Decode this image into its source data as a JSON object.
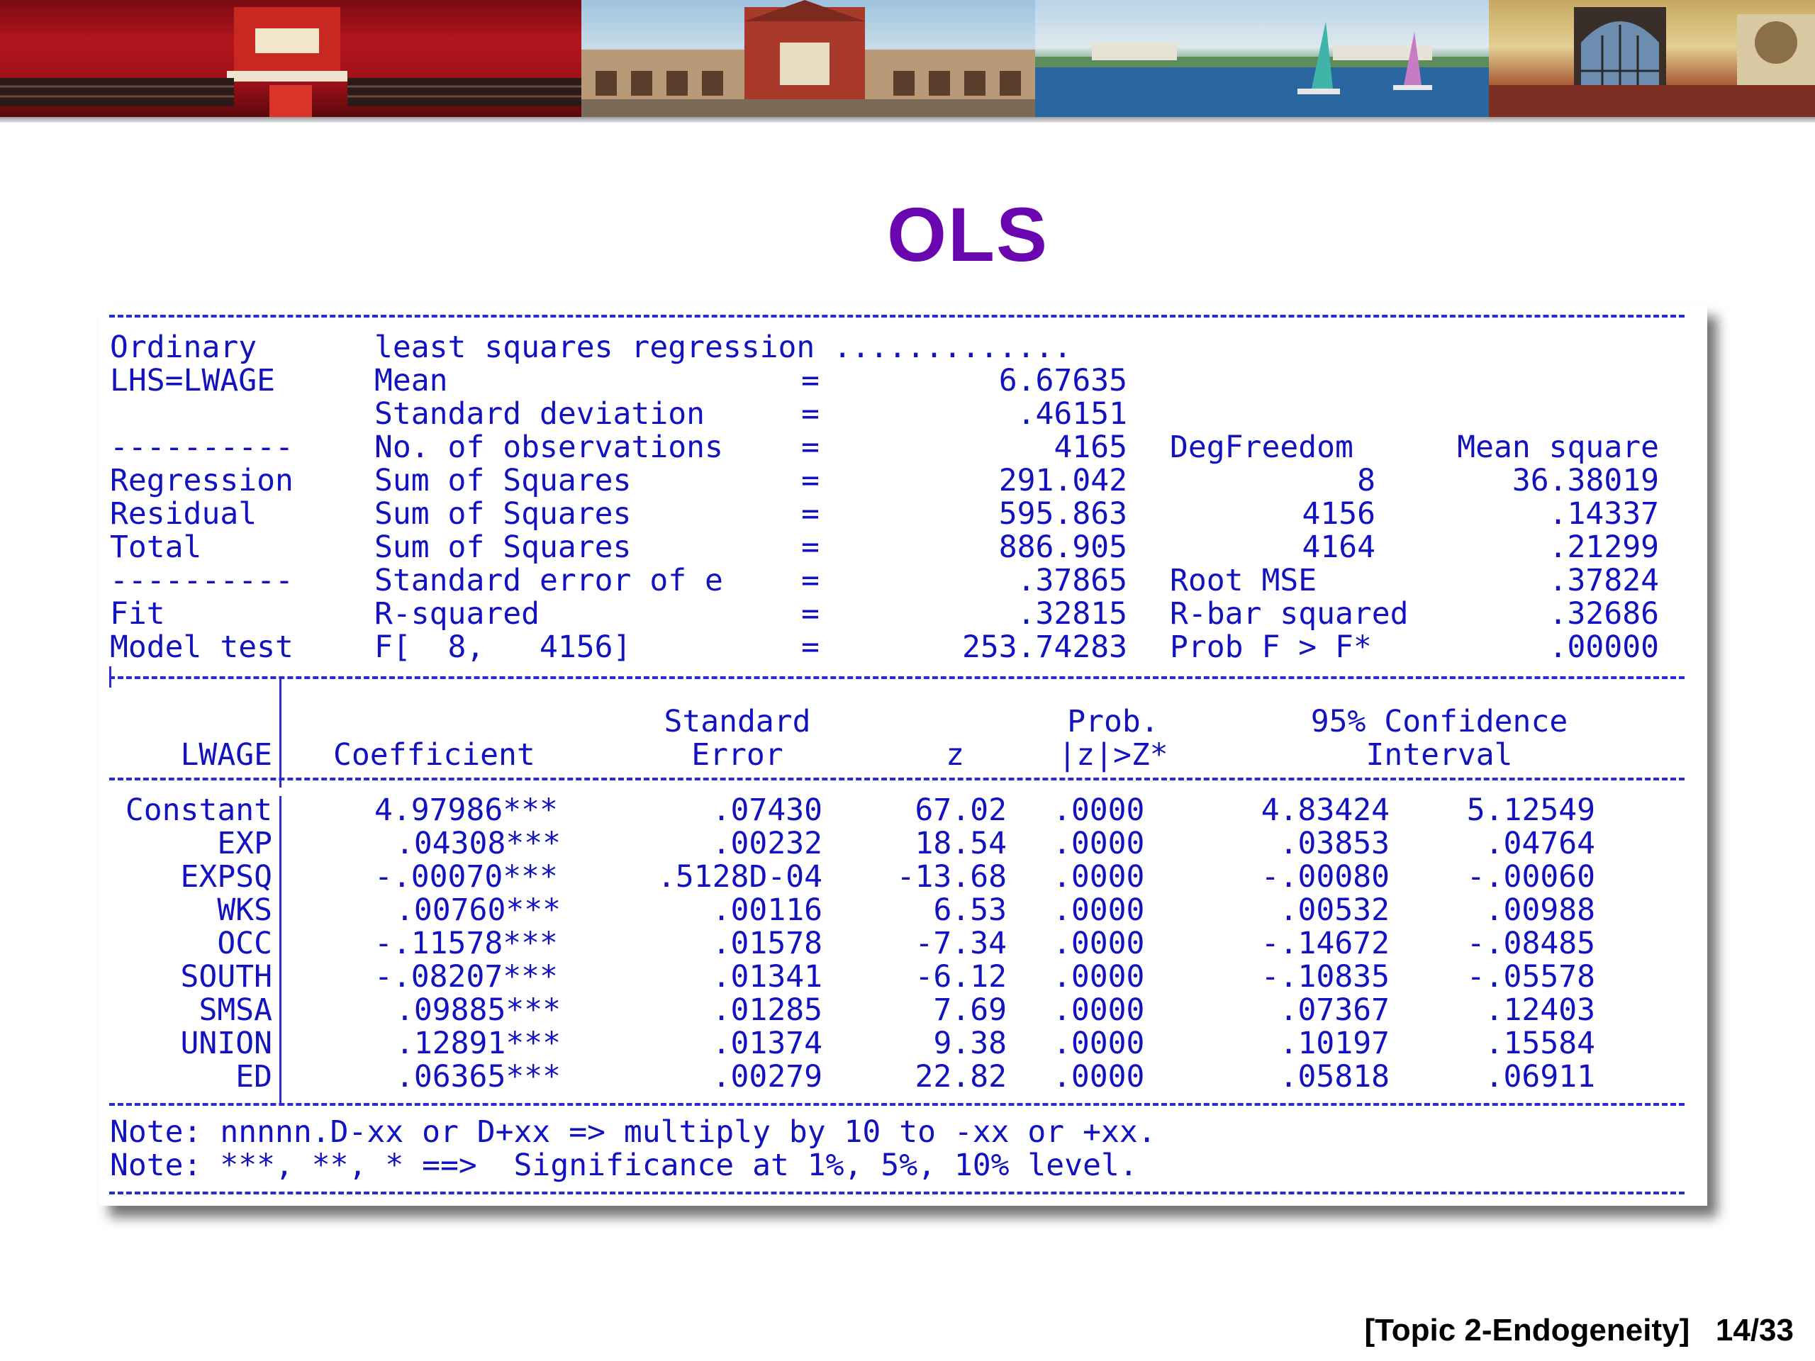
{
  "slide": {
    "title": "OLS",
    "footer": "[Topic 2-Endogeneity]   14/33"
  },
  "summary": {
    "row0": {
      "left": "Ordinary",
      "label": "least squares regression .............",
      "eq": "",
      "value": "",
      "df": "",
      "ms": ""
    },
    "row1": {
      "left": "LHS=LWAGE",
      "label": "Mean",
      "eq": "=",
      "value": "6.67635",
      "df": "",
      "ms": ""
    },
    "row2": {
      "left": "",
      "label": "Standard deviation",
      "eq": "=",
      "value": ".46151",
      "df": "",
      "ms": ""
    },
    "row3": {
      "left": "----------",
      "label": "No. of observations",
      "eq": "=",
      "value": "4165",
      "df": "DegFreedom",
      "ms": "Mean square"
    },
    "row4": {
      "left": "Regression",
      "label": "Sum of Squares",
      "eq": "=",
      "value": "291.042",
      "df": "8",
      "ms": "36.38019"
    },
    "row5": {
      "left": "Residual",
      "label": "Sum of Squares",
      "eq": "=",
      "value": "595.863",
      "df": "4156",
      "ms": ".14337"
    },
    "row6": {
      "left": "Total",
      "label": "Sum of Squares",
      "eq": "=",
      "value": "886.905",
      "df": "4164",
      "ms": ".21299"
    },
    "row7": {
      "left": "----------",
      "label": "Standard error of e",
      "eq": "=",
      "value": ".37865",
      "df": "Root MSE",
      "ms": ".37824"
    },
    "row8": {
      "left": "Fit",
      "label": "R-squared",
      "eq": "=",
      "value": ".32815",
      "df": "R-bar squared",
      "ms": ".32686"
    },
    "row9": {
      "left": "Model test",
      "label": "F[  8,   4156]",
      "eq": "=",
      "value": "253.74283",
      "df": "Prob F > F*",
      "ms": ".00000"
    }
  },
  "coef_header": {
    "var": "LWAGE",
    "coef": "Coefficient",
    "se1": "Standard",
    "se2": "Error",
    "z": "z",
    "prob1": "Prob.",
    "prob2": "|z|>Z*",
    "ci1": "95% Confidence",
    "ci2": "Interval"
  },
  "coef_rows": [
    {
      "var": "Constant",
      "coef": "4.97986***",
      "se": ".07430",
      "z": "67.02",
      "p": ".0000",
      "lo": "4.83424",
      "hi": "5.12549"
    },
    {
      "var": "EXP",
      "coef": ".04308***",
      "se": ".00232",
      "z": "18.54",
      "p": ".0000",
      "lo": ".03853",
      "hi": ".04764"
    },
    {
      "var": "EXPSQ",
      "coef": "-.00070***",
      "se": ".5128D-04",
      "z": "-13.68",
      "p": ".0000",
      "lo": "-.00080",
      "hi": "-.00060"
    },
    {
      "var": "WKS",
      "coef": ".00760***",
      "se": ".00116",
      "z": "6.53",
      "p": ".0000",
      "lo": ".00532",
      "hi": ".00988"
    },
    {
      "var": "OCC",
      "coef": "-.11578***",
      "se": ".01578",
      "z": "-7.34",
      "p": ".0000",
      "lo": "-.14672",
      "hi": "-.08485"
    },
    {
      "var": "SOUTH",
      "coef": "-.08207***",
      "se": ".01341",
      "z": "-6.12",
      "p": ".0000",
      "lo": "-.10835",
      "hi": "-.05578"
    },
    {
      "var": "SMSA",
      "coef": ".09885***",
      "se": ".01285",
      "z": "7.69",
      "p": ".0000",
      "lo": ".07367",
      "hi": ".12403"
    },
    {
      "var": "UNION",
      "coef": ".12891***",
      "se": ".01374",
      "z": "9.38",
      "p": ".0000",
      "lo": ".10197",
      "hi": ".15584"
    },
    {
      "var": "ED",
      "coef": ".06365***",
      "se": ".00279",
      "z": "22.82",
      "p": ".0000",
      "lo": ".05818",
      "hi": ".06911"
    }
  ],
  "notes": {
    "note1": "Note: nnnnn.D-xx or D+xx => multiply by 10 to -xx or +xx.",
    "note2": "Note: ***, **, * ==>  Significance at 1%, 5%, 10% level."
  }
}
